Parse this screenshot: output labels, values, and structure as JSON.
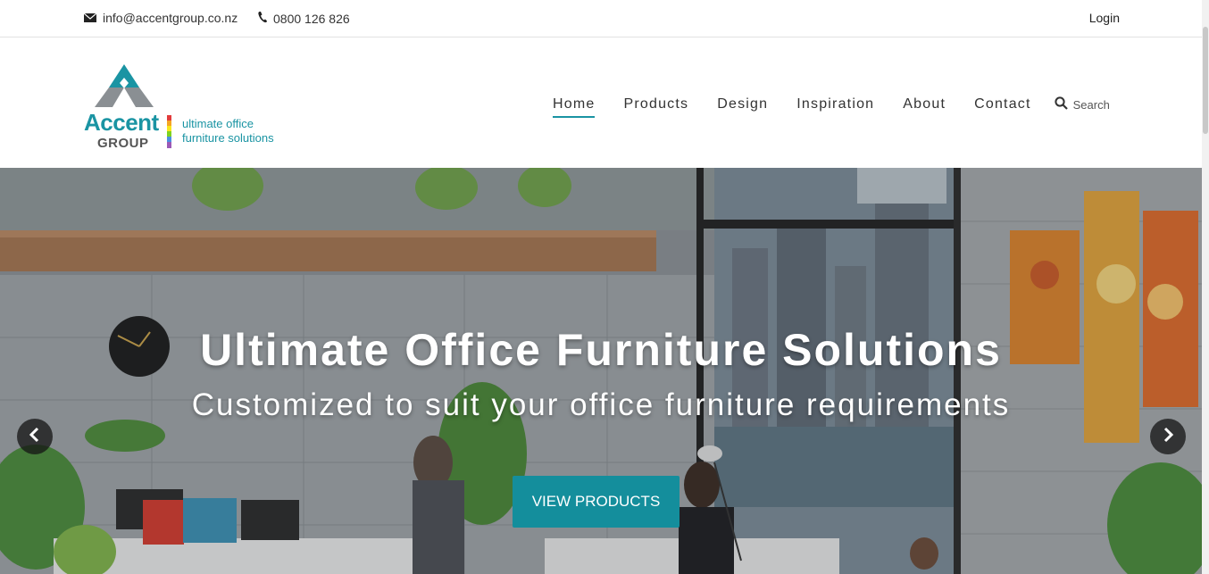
{
  "topbar": {
    "email": "info@accentgroup.co.nz",
    "email_icon": "envelope-icon",
    "phone": "0800 126 826",
    "phone_icon": "phone-icon",
    "login": "Login"
  },
  "logo": {
    "name": "Accent",
    "group": "GROUP",
    "tagline_line1": "ultimate office",
    "tagline_line2": "furniture solutions"
  },
  "nav": {
    "items": [
      {
        "label": "Home",
        "active": true
      },
      {
        "label": "Products",
        "active": false
      },
      {
        "label": "Design",
        "active": false
      },
      {
        "label": "Inspiration",
        "active": false
      },
      {
        "label": "About",
        "active": false
      },
      {
        "label": "Contact",
        "active": false
      }
    ],
    "search_label": "Search",
    "search_icon": "search-icon"
  },
  "hero": {
    "title": "Ultimate Office Furniture Solutions",
    "subtitle": "Customized to suit your office furniture requirements",
    "cta": "VIEW PRODUCTS",
    "prev_icon": "chevron-left-icon",
    "next_icon": "chevron-right-icon"
  },
  "colors": {
    "accent": "#1a94a3",
    "cta_bg": "#148e9c",
    "logo_bar": [
      "#e23b3b",
      "#f5a623",
      "#f8e71c",
      "#7ed321",
      "#4a90e2",
      "#9b59b6"
    ]
  }
}
